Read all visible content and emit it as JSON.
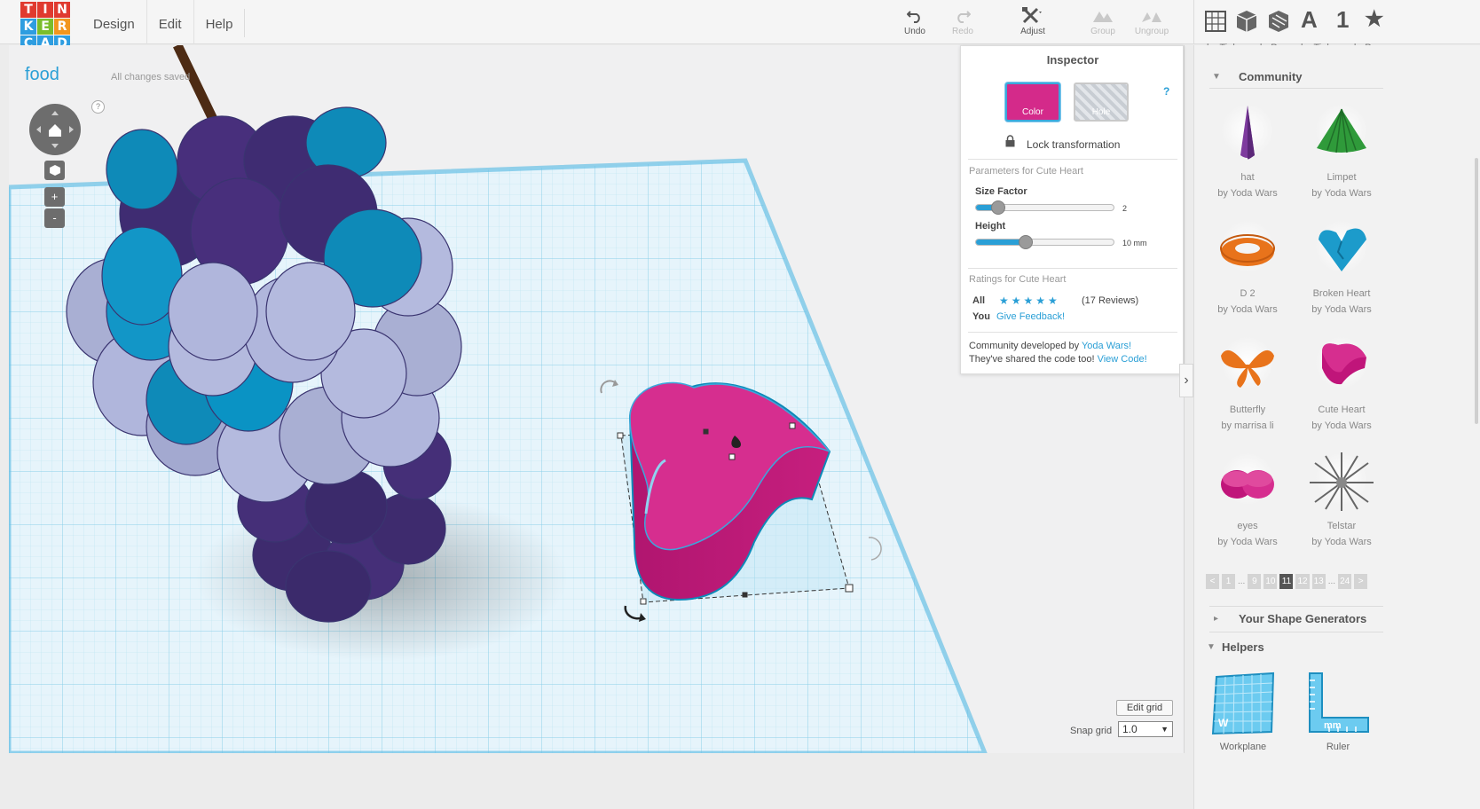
{
  "logo": {
    "letters": [
      "T",
      "I",
      "N",
      "K",
      "E",
      "R",
      "C",
      "A",
      "D"
    ],
    "colors": [
      "#e03a2f",
      "#e03a2f",
      "#e03a2f",
      "#2e9de0",
      "#7bbd2c",
      "#f2961e",
      "#2e9de0",
      "#2e9de0",
      "#2e9de0"
    ]
  },
  "menu": {
    "design": "Design",
    "edit": "Edit",
    "help": "Help"
  },
  "toolbar": {
    "undo": "Undo",
    "redo": "Redo",
    "adjust": "Adjust",
    "group": "Group",
    "ungroup": "Ungroup"
  },
  "topright": {
    "letter_a": "A",
    "digit_1": "1",
    "caption_left": "by Tinkercad - P...",
    "caption_right": "by Tinkercad - P..."
  },
  "workspace": {
    "title": "food",
    "saved_status": "All changes saved",
    "help": "?",
    "zoom_in": "+",
    "zoom_out": "-",
    "edit_grid": "Edit grid",
    "snap_label": "Snap grid",
    "snap_value": "1.0"
  },
  "inspector": {
    "title": "Inspector",
    "color_label": "Color",
    "hole_label": "Hole",
    "help": "?",
    "lock_label": "Lock transformation",
    "params_heading": "Parameters for Cute Heart",
    "size_factor_label": "Size Factor",
    "size_factor_value": "2",
    "size_factor_level": 0.12,
    "height_label": "Height",
    "height_value": "10 mm",
    "height_level": 0.32,
    "ratings_heading": "Ratings for Cute Heart",
    "all_label": "All",
    "stars": "★★★★★",
    "reviews": "(17 Reviews)",
    "you_label": "You",
    "feedback_link": "Give Feedback!",
    "community_prefix": "Community developed by ",
    "community_author": "Yoda Wars!",
    "shared_prefix": "They've shared the code too! ",
    "view_code": "View Code!",
    "accent_color": "#d42a8a"
  },
  "panel": {
    "community_heading": "Community",
    "shapes": [
      {
        "name": "hat",
        "author": "by Yoda Wars"
      },
      {
        "name": "Limpet",
        "author": "by Yoda Wars"
      },
      {
        "name": "D 2",
        "author": "by Yoda Wars"
      },
      {
        "name": "Broken Heart",
        "author": "by Yoda Wars"
      },
      {
        "name": "Butterfly",
        "author": "by marrisa li"
      },
      {
        "name": "Cute Heart",
        "author": "by Yoda Wars"
      },
      {
        "name": "eyes",
        "author": "by Yoda Wars"
      },
      {
        "name": "Telstar",
        "author": "by Yoda Wars"
      }
    ],
    "pager": [
      "<",
      "1",
      "...",
      "9",
      "10",
      "11",
      "12",
      "13",
      "...",
      "24",
      ">"
    ],
    "pager_current": "11",
    "generators_heading": "Your Shape Generators",
    "helpers_heading": "Helpers",
    "helpers": [
      {
        "name": "Workplane",
        "badge": "W"
      },
      {
        "name": "Ruler",
        "badge": "mm"
      }
    ]
  }
}
